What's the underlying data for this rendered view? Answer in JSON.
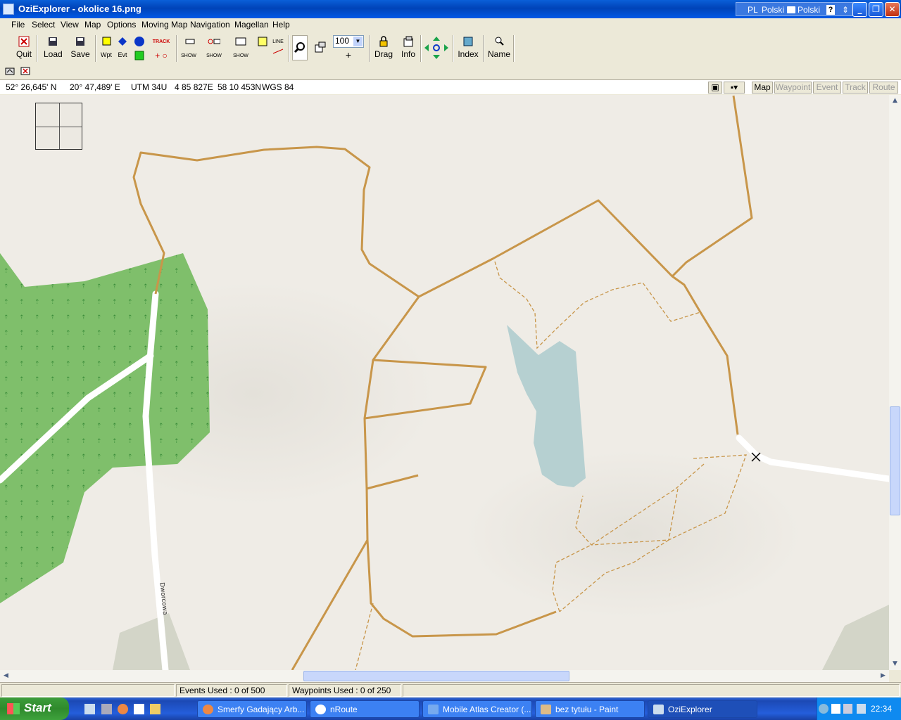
{
  "window": {
    "title": "OziExplorer - okolice 16.png",
    "lang_code": "PL",
    "lang_name": "Polski",
    "keyboard_label": "Polski"
  },
  "menu": [
    "File",
    "Select",
    "View",
    "Map",
    "Options",
    "Moving Map",
    "Navigation",
    "Magellan",
    "Help"
  ],
  "toolbar": {
    "quit": "Quit",
    "load": "Load",
    "save": "Save",
    "wpt": "Wpt",
    "evt": "Evt",
    "track": "TRACK",
    "show": "SHOW",
    "line": "LINE",
    "zoom_value": "100",
    "drag": "Drag",
    "info": "Info",
    "index": "Index",
    "name": "Name"
  },
  "coords": {
    "lat": "52° 26,645' N",
    "lon": "20° 47,489' E",
    "grid": "UTM 34U",
    "easting": "4 85 827E",
    "northing": "58 10 453N",
    "datum": "WGS 84"
  },
  "view_tabs": {
    "map": "Map",
    "waypoint": "Waypoint",
    "event": "Event",
    "track": "Track",
    "route": "Route"
  },
  "map": {
    "street_label": "Dworcowa",
    "colors": {
      "background": "#efece6",
      "forest": "#7fbf6b",
      "water": "#b6d0d1",
      "track_road": "#c8964a",
      "residential_road": "#ffffff",
      "grassland": "#d3d5c8"
    }
  },
  "status": {
    "events_used": "Events Used : 0 of 500",
    "waypoints_used": "Waypoints Used : 0 of 250"
  },
  "taskbar": {
    "start": "Start",
    "tasks": [
      "Smerfy Gadający Arb...",
      "nRoute",
      "Mobile Atlas Creator (...",
      "bez tytułu - Paint",
      "OziExplorer"
    ],
    "clock": "22:34"
  }
}
